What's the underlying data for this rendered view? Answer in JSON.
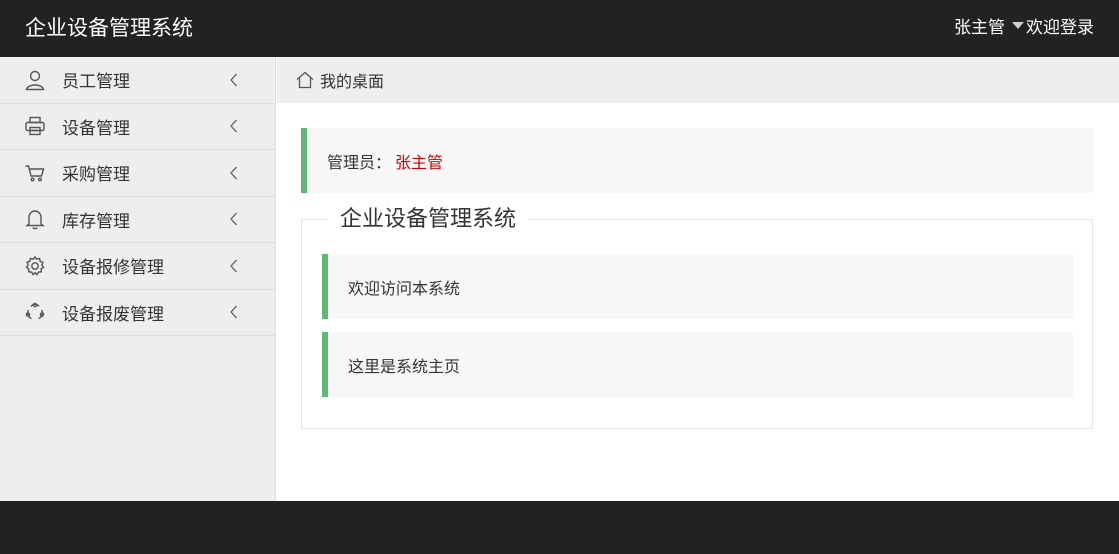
{
  "header": {
    "app_title": "企业设备管理系统",
    "user_name": "张主管",
    "welcome_text": "欢迎登录"
  },
  "sidebar": {
    "items": [
      {
        "label": "员工管理",
        "icon": "user-icon"
      },
      {
        "label": "设备管理",
        "icon": "printer-icon"
      },
      {
        "label": "采购管理",
        "icon": "cart-icon"
      },
      {
        "label": "库存管理",
        "icon": "bell-icon"
      },
      {
        "label": "设备报修管理",
        "icon": "gear-icon"
      },
      {
        "label": "设备报废管理",
        "icon": "recycle-icon"
      }
    ]
  },
  "breadcrumb": {
    "icon": "home-icon",
    "label": "我的桌面"
  },
  "admin": {
    "label": "管理员：",
    "name": "张主管"
  },
  "panel": {
    "legend": "企业设备管理系统",
    "quotes": [
      "欢迎访问本系统",
      "这里是系统主页"
    ]
  },
  "colors": {
    "header_bg": "#222222",
    "accent_green": "#5fb878",
    "admin_name_red": "#cc0000",
    "sidebar_bg": "#eeeeee"
  }
}
